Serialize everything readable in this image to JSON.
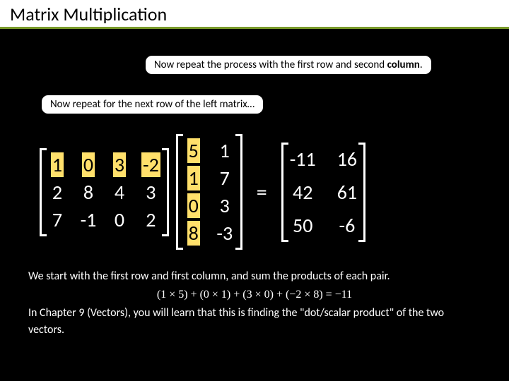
{
  "title": "Matrix Multiplication",
  "callouts": {
    "c1_prefix": "Now repeat the process with the first row and second ",
    "c1_bold": "column",
    "c1_suffix": ".",
    "c2": "Now repeat for the next row of the left matrix…"
  },
  "matrixA": {
    "rows": 3,
    "cols": 4,
    "cells": [
      [
        "1",
        "0",
        "3",
        "-2"
      ],
      [
        "2",
        "8",
        "4",
        "3"
      ],
      [
        "7",
        "-1",
        "0",
        "2"
      ]
    ],
    "highlight_row": 0
  },
  "matrixB": {
    "rows": 4,
    "cols": 2,
    "cells": [
      [
        "5",
        "1"
      ],
      [
        "1",
        "7"
      ],
      [
        "0",
        "3"
      ],
      [
        "8",
        "-3"
      ]
    ],
    "highlight_col": 0
  },
  "equals": "=",
  "matrixC": {
    "rows": 3,
    "cols": 2,
    "cells": [
      [
        "-11",
        "16"
      ],
      [
        "42",
        "61"
      ],
      [
        "50",
        "-6"
      ]
    ]
  },
  "explain": {
    "line1": "We start with the first row and first column, and sum the products of each pair.",
    "eq": "(1 × 5) + (0 × 1) + (3 × 0) + (−2 × 8) = −11",
    "line2": "In Chapter 9 (Vectors), you will learn that this is finding the \"dot/scalar product\" of the two vectors."
  }
}
